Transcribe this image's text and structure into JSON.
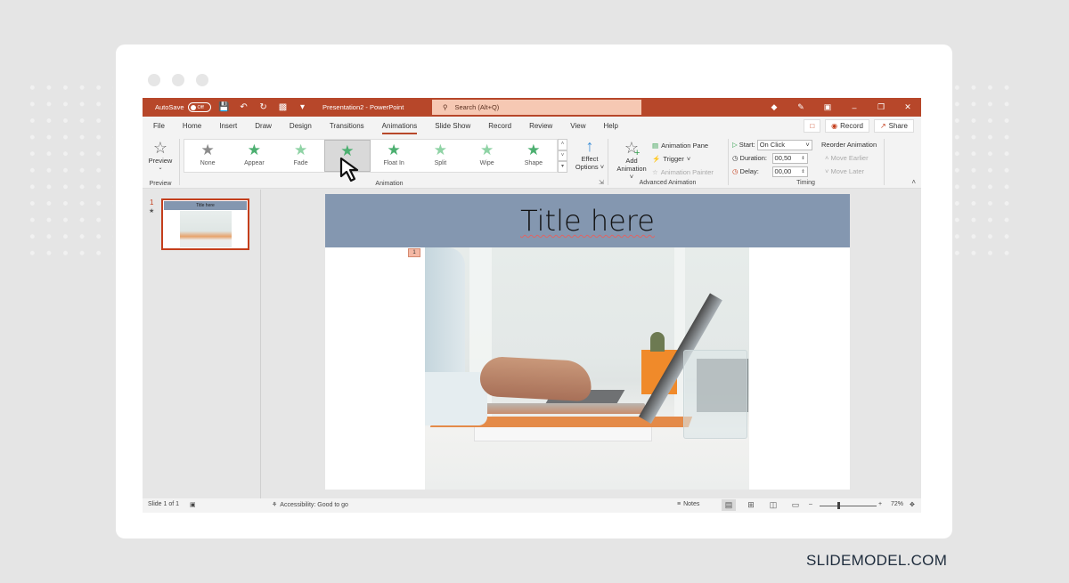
{
  "brand": "SLIDEMODEL.COM",
  "titlebar": {
    "autosave_label": "AutoSave",
    "autosave_state": "Off",
    "document_title": "Presentation2  -  PowerPoint",
    "search_placeholder": "Search (Alt+Q)"
  },
  "tabs": [
    "File",
    "Home",
    "Insert",
    "Draw",
    "Design",
    "Transitions",
    "Animations",
    "Slide Show",
    "Record",
    "Review",
    "View",
    "Help"
  ],
  "active_tab": "Animations",
  "tab_actions": {
    "record": "Record",
    "share": "Share"
  },
  "ribbon": {
    "preview": {
      "button": "Preview",
      "group": "Preview"
    },
    "animation": {
      "group": "Animation",
      "gallery": [
        {
          "label": "None",
          "icon": "star-gray-icon"
        },
        {
          "label": "Appear",
          "icon": "star-burst-green-icon"
        },
        {
          "label": "Fade",
          "icon": "star-fade-green-icon"
        },
        {
          "label": "",
          "icon": "star-fly-in-green-icon",
          "hovered": true
        },
        {
          "label": "Float In",
          "icon": "star-green-icon"
        },
        {
          "label": "Split",
          "icon": "star-split-green-icon"
        },
        {
          "label": "Wipe",
          "icon": "star-wipe-green-icon"
        },
        {
          "label": "Shape",
          "icon": "star-shape-green-icon"
        }
      ],
      "effect_options_line1": "Effect",
      "effect_options_line2": "Options"
    },
    "advanced": {
      "group": "Advanced Animation",
      "add_line1": "Add",
      "add_line2": "Animation",
      "animation_pane": "Animation Pane",
      "trigger": "Trigger",
      "animation_painter": "Animation Painter"
    },
    "timing": {
      "group": "Timing",
      "start_label": "Start:",
      "start_value": "On Click",
      "duration_label": "Duration:",
      "duration_value": "00,50",
      "delay_label": "Delay:",
      "delay_value": "00,00",
      "reorder_title": "Reorder Animation",
      "move_earlier": "Move Earlier",
      "move_later": "Move Later"
    }
  },
  "thumbnails": [
    {
      "number": "1",
      "title": "Title here"
    }
  ],
  "slide": {
    "title": "Title here",
    "animation_badge": "1"
  },
  "statusbar": {
    "slide_count": "Slide 1 of 1",
    "accessibility": "Accessibility: Good to go",
    "notes": "Notes",
    "zoom_level": "72%"
  }
}
